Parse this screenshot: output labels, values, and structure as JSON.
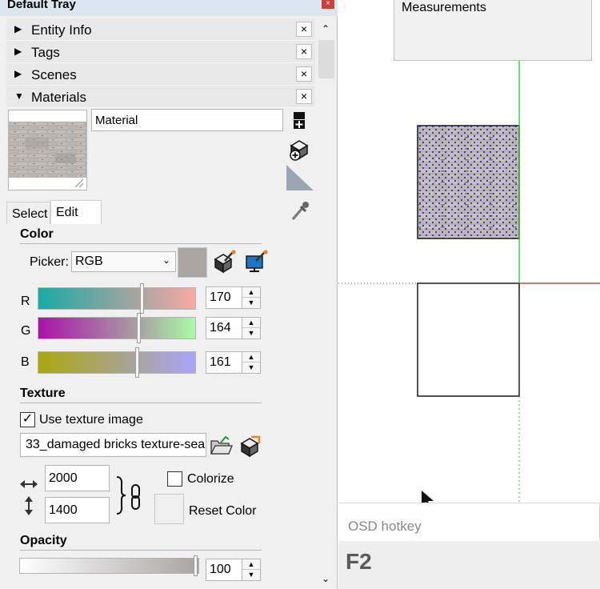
{
  "tray": {
    "title": "Default Tray",
    "close_glyph": "×",
    "panels": [
      {
        "label": "Entity Info",
        "expanded": false,
        "arrow": "▶"
      },
      {
        "label": "Tags",
        "expanded": false,
        "arrow": "▶"
      },
      {
        "label": "Scenes",
        "expanded": false,
        "arrow": "▶"
      },
      {
        "label": "Materials",
        "expanded": true,
        "arrow": "▼"
      }
    ],
    "panel_close_glyph": "×"
  },
  "materials": {
    "name_value": "Material",
    "tabs": [
      "Select",
      "Edit"
    ],
    "active_tab": "Edit",
    "color": {
      "title": "Color",
      "picker_label": "Picker:",
      "picker_value": "RGB",
      "swatch_hex": "#aaa4a1",
      "channels": [
        {
          "label": "R",
          "value": "170",
          "max": 255
        },
        {
          "label": "G",
          "value": "164",
          "max": 255
        },
        {
          "label": "B",
          "value": "161",
          "max": 255
        }
      ]
    },
    "texture": {
      "title": "Texture",
      "use_texture_label": "Use texture image",
      "use_texture_checked": true,
      "file_value": "33_damaged bricks texture-sear",
      "width_value": "2000",
      "height_value": "1400",
      "colorize_label": "Colorize",
      "colorize_checked": false,
      "reset_color_label": "Reset Color"
    },
    "opacity": {
      "title": "Opacity",
      "value": "100"
    }
  },
  "viewport": {
    "measurements_label": "Measurements",
    "osd_header": "OSD hotkey",
    "osd_key": "F2"
  },
  "colors": {
    "green_axis": "#3fbf3f",
    "red_axis": "#d22020",
    "tray_title_bg": "#dce6f0"
  }
}
